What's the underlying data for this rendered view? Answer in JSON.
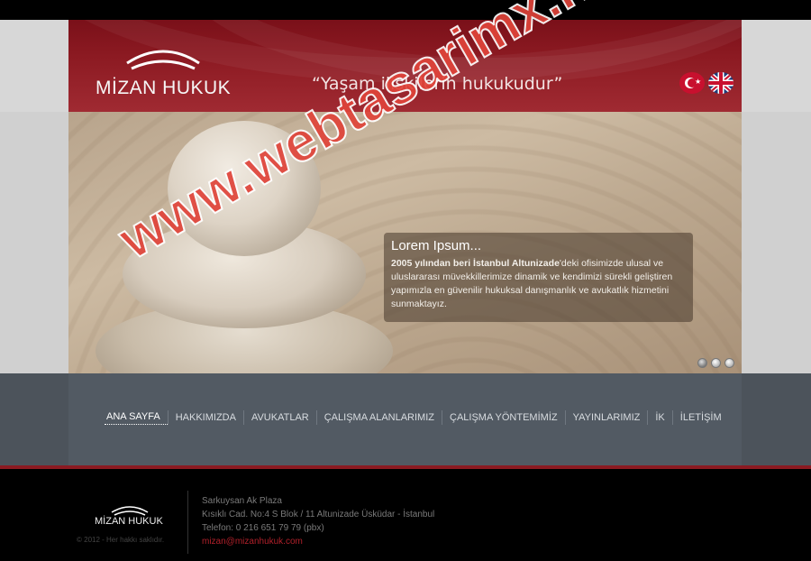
{
  "header": {
    "logo_text": "MİZAN HUKUK",
    "slogan": "“Yaşam ilişkilerin hukukudur”",
    "languages": [
      "turkish-flag-icon",
      "uk-flag-icon"
    ]
  },
  "slider": {
    "caption_title": "Lorem Ipsum...",
    "caption_bold": "2005 yılından beri İstanbul Altunizade",
    "caption_text": "'deki ofisimizde ulusal ve uluslararası müvekkillerimize dinamik ve kendimizi sürekli geliştiren yapımızla en güvenilir hukuksal danışmanlık ve avukatlık hizmetini sunmaktayız.",
    "dots": 3,
    "active_dot": 1
  },
  "nav": {
    "items": [
      "ANA SAYFA",
      "HAKKIMIZDA",
      "AVUKATLAR",
      "ÇALIŞMA ALANLARIMIZ",
      "ÇALIŞMA YÖNTEMİMİZ",
      "YAYINLARIMIZ",
      "İK",
      "İLETİŞİM"
    ],
    "active": "ANA SAYFA"
  },
  "footer": {
    "logo_text": "MİZAN HUKUK",
    "copyright": "© 2012 - Her hakkı saklıdır.",
    "address_1": "Sarkuysan Ak Plaza",
    "address_2": "Kısıklı Cad. No:4 S Blok / 11 Altunizade Üsküdar - İstanbul",
    "phone": "Telefon: 0 216 651 79 79 (pbx)",
    "email": "mizan@mizanhukuk.com"
  },
  "watermark": "www.webtasarimx.net",
  "colors": {
    "brand_red": "#8c1a22",
    "nav_bg": "#525a63",
    "footer_bg": "#000000"
  }
}
